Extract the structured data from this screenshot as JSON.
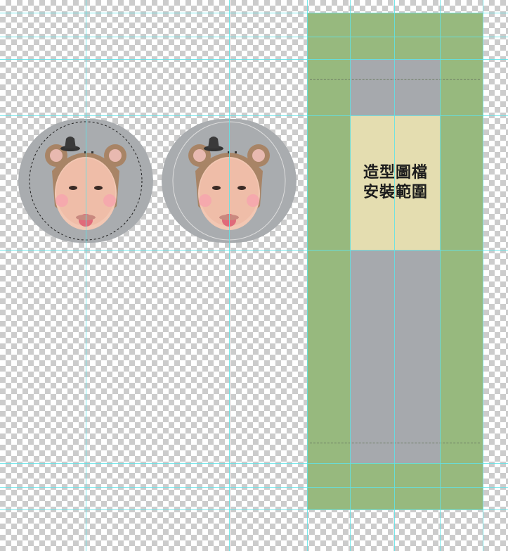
{
  "mockup": {
    "install_label_line1": "造型圖檔",
    "install_label_line2": "安裝範圍"
  },
  "colors": {
    "green": "#97b97e",
    "gray": "#a6a9ad",
    "yellow": "#e4ddb0",
    "badge_gray": "#a9acaf",
    "guide": "#5fe3e7",
    "checker": "#cccccc"
  },
  "badges": [
    {
      "icon": "baby-bear-avatar-icon"
    },
    {
      "icon": "baby-bear-avatar-icon"
    }
  ]
}
